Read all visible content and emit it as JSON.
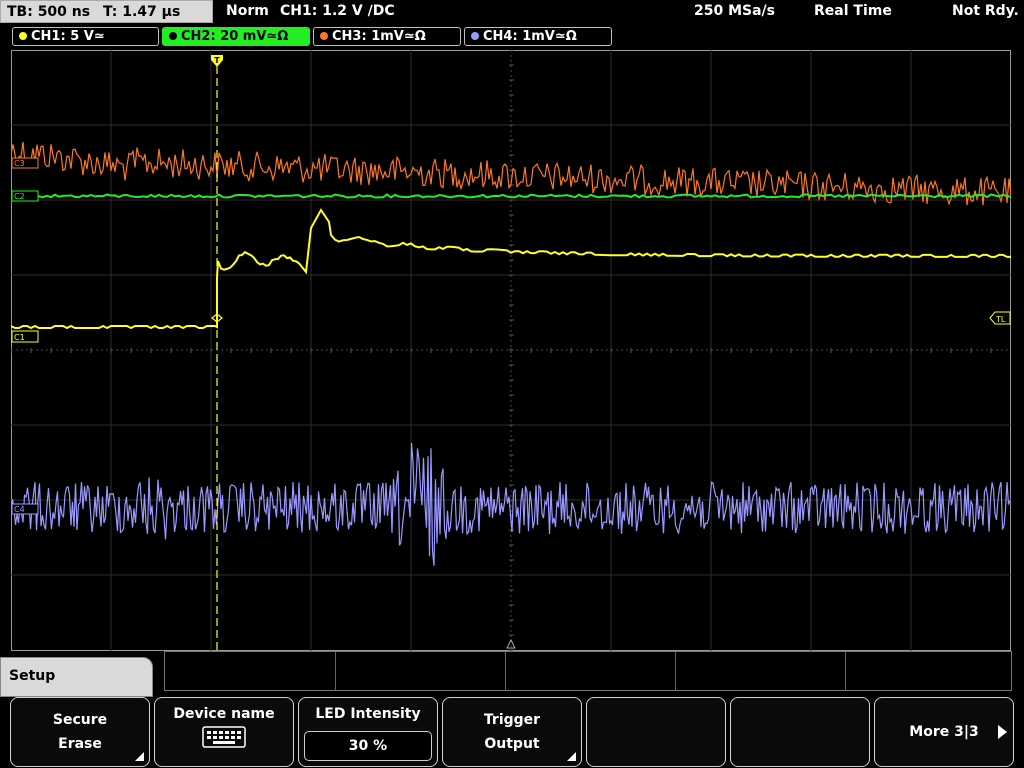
{
  "status": {
    "timebase": "TB: 500 ns",
    "trigger_time": "T: 1.47 µs",
    "mode": "Norm",
    "trigger": "CH1: 1.2 V ∕DC",
    "sample_rate": "250 MSa/s",
    "acq_mode": "Real Time",
    "state": "Not Rdy."
  },
  "channels": [
    {
      "label": "CH1: 5 V≃",
      "color": "#ffff22",
      "active": false
    },
    {
      "label": "CH2: 20 mV≃Ω",
      "color": "#22ee22",
      "active": true
    },
    {
      "label": "CH3: 1mV≃Ω",
      "color": "#ff7722",
      "active": false
    },
    {
      "label": "CH4: 1mV≃Ω",
      "color": "#9999ff",
      "active": false
    }
  ],
  "markers": {
    "c3": "C3",
    "c2": "C2",
    "c1": "C1",
    "c4": "C4",
    "trigger_level": "TL",
    "trigger_pos": "T"
  },
  "menu": {
    "title": "Setup",
    "softkeys": [
      {
        "line1": "Secure",
        "line2": "Erase"
      },
      {
        "line1": "Device name",
        "icon": "keyboard-icon"
      },
      {
        "line1": "LED Intensity",
        "value": "30 %"
      },
      {
        "line1": "Trigger",
        "line2": "Output"
      },
      {
        "line1": ""
      },
      {
        "line1": ""
      },
      {
        "line1": "More 3|3"
      }
    ]
  }
}
